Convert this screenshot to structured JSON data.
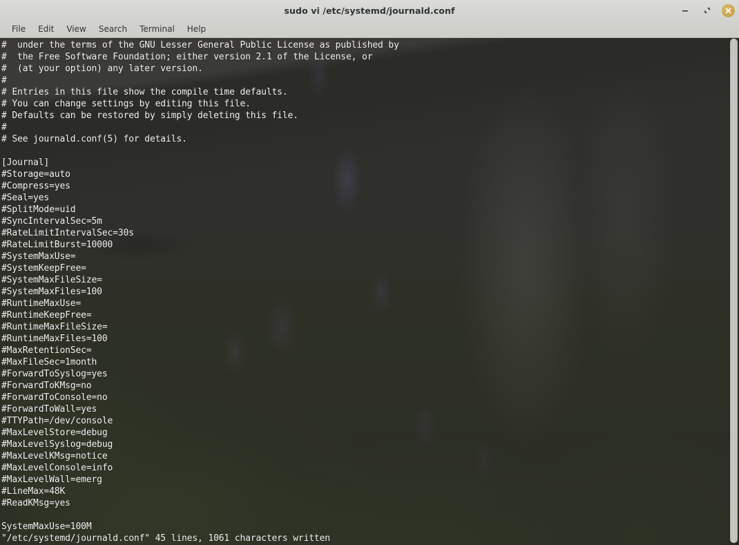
{
  "window": {
    "title": "sudo vi /etc/systemd/journald.conf",
    "controls": {
      "minimize_label": "–",
      "maximize_label": "⤡",
      "close_label": "×"
    },
    "close_button_color": "#c4a348",
    "titlebar_color": "#d6d6d2"
  },
  "menubar": {
    "items": [
      {
        "label": "File"
      },
      {
        "label": "Edit"
      },
      {
        "label": "View"
      },
      {
        "label": "Search"
      },
      {
        "label": "Terminal"
      },
      {
        "label": "Help"
      }
    ]
  },
  "terminal": {
    "foreground_color": "#f2f2f0",
    "background_color": "#2a2a28",
    "lines": [
      "#  under the terms of the GNU Lesser General Public License as published by",
      "#  the Free Software Foundation; either version 2.1 of the License, or",
      "#  (at your option) any later version.",
      "#",
      "# Entries in this file show the compile time defaults.",
      "# You can change settings by editing this file.",
      "# Defaults can be restored by simply deleting this file.",
      "#",
      "# See journald.conf(5) for details.",
      "",
      "[Journal]",
      "#Storage=auto",
      "#Compress=yes",
      "#Seal=yes",
      "#SplitMode=uid",
      "#SyncIntervalSec=5m",
      "#RateLimitIntervalSec=30s",
      "#RateLimitBurst=10000",
      "#SystemMaxUse=",
      "#SystemKeepFree=",
      "#SystemMaxFileSize=",
      "#SystemMaxFiles=100",
      "#RuntimeMaxUse=",
      "#RuntimeKeepFree=",
      "#RuntimeMaxFileSize=",
      "#RuntimeMaxFiles=100",
      "#MaxRetentionSec=",
      "#MaxFileSec=1month",
      "#ForwardToSyslog=yes",
      "#ForwardToKMsg=no",
      "#ForwardToConsole=no",
      "#ForwardToWall=yes",
      "#TTYPath=/dev/console",
      "#MaxLevelStore=debug",
      "#MaxLevelSyslog=debug",
      "#MaxLevelKMsg=notice",
      "#MaxLevelConsole=info",
      "#MaxLevelWall=emerg",
      "#LineMax=48K",
      "#ReadKMsg=yes",
      "",
      "SystemMaxUse=100M",
      "\"/etc/systemd/journald.conf\" 45 lines, 1061 characters written"
    ]
  },
  "scrollbar": {
    "thumb_color": "#c8c8c3",
    "position": "top"
  }
}
